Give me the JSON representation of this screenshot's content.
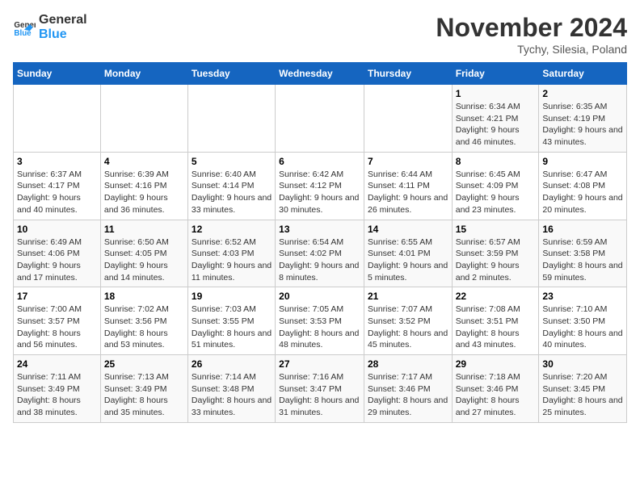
{
  "logo": {
    "general": "General",
    "blue": "Blue"
  },
  "header": {
    "month": "November 2024",
    "location": "Tychy, Silesia, Poland"
  },
  "weekdays": [
    "Sunday",
    "Monday",
    "Tuesday",
    "Wednesday",
    "Thursday",
    "Friday",
    "Saturday"
  ],
  "weeks": [
    [
      {
        "day": "",
        "info": ""
      },
      {
        "day": "",
        "info": ""
      },
      {
        "day": "",
        "info": ""
      },
      {
        "day": "",
        "info": ""
      },
      {
        "day": "",
        "info": ""
      },
      {
        "day": "1",
        "info": "Sunrise: 6:34 AM\nSunset: 4:21 PM\nDaylight: 9 hours and 46 minutes."
      },
      {
        "day": "2",
        "info": "Sunrise: 6:35 AM\nSunset: 4:19 PM\nDaylight: 9 hours and 43 minutes."
      }
    ],
    [
      {
        "day": "3",
        "info": "Sunrise: 6:37 AM\nSunset: 4:17 PM\nDaylight: 9 hours and 40 minutes."
      },
      {
        "day": "4",
        "info": "Sunrise: 6:39 AM\nSunset: 4:16 PM\nDaylight: 9 hours and 36 minutes."
      },
      {
        "day": "5",
        "info": "Sunrise: 6:40 AM\nSunset: 4:14 PM\nDaylight: 9 hours and 33 minutes."
      },
      {
        "day": "6",
        "info": "Sunrise: 6:42 AM\nSunset: 4:12 PM\nDaylight: 9 hours and 30 minutes."
      },
      {
        "day": "7",
        "info": "Sunrise: 6:44 AM\nSunset: 4:11 PM\nDaylight: 9 hours and 26 minutes."
      },
      {
        "day": "8",
        "info": "Sunrise: 6:45 AM\nSunset: 4:09 PM\nDaylight: 9 hours and 23 minutes."
      },
      {
        "day": "9",
        "info": "Sunrise: 6:47 AM\nSunset: 4:08 PM\nDaylight: 9 hours and 20 minutes."
      }
    ],
    [
      {
        "day": "10",
        "info": "Sunrise: 6:49 AM\nSunset: 4:06 PM\nDaylight: 9 hours and 17 minutes."
      },
      {
        "day": "11",
        "info": "Sunrise: 6:50 AM\nSunset: 4:05 PM\nDaylight: 9 hours and 14 minutes."
      },
      {
        "day": "12",
        "info": "Sunrise: 6:52 AM\nSunset: 4:03 PM\nDaylight: 9 hours and 11 minutes."
      },
      {
        "day": "13",
        "info": "Sunrise: 6:54 AM\nSunset: 4:02 PM\nDaylight: 9 hours and 8 minutes."
      },
      {
        "day": "14",
        "info": "Sunrise: 6:55 AM\nSunset: 4:01 PM\nDaylight: 9 hours and 5 minutes."
      },
      {
        "day": "15",
        "info": "Sunrise: 6:57 AM\nSunset: 3:59 PM\nDaylight: 9 hours and 2 minutes."
      },
      {
        "day": "16",
        "info": "Sunrise: 6:59 AM\nSunset: 3:58 PM\nDaylight: 8 hours and 59 minutes."
      }
    ],
    [
      {
        "day": "17",
        "info": "Sunrise: 7:00 AM\nSunset: 3:57 PM\nDaylight: 8 hours and 56 minutes."
      },
      {
        "day": "18",
        "info": "Sunrise: 7:02 AM\nSunset: 3:56 PM\nDaylight: 8 hours and 53 minutes."
      },
      {
        "day": "19",
        "info": "Sunrise: 7:03 AM\nSunset: 3:55 PM\nDaylight: 8 hours and 51 minutes."
      },
      {
        "day": "20",
        "info": "Sunrise: 7:05 AM\nSunset: 3:53 PM\nDaylight: 8 hours and 48 minutes."
      },
      {
        "day": "21",
        "info": "Sunrise: 7:07 AM\nSunset: 3:52 PM\nDaylight: 8 hours and 45 minutes."
      },
      {
        "day": "22",
        "info": "Sunrise: 7:08 AM\nSunset: 3:51 PM\nDaylight: 8 hours and 43 minutes."
      },
      {
        "day": "23",
        "info": "Sunrise: 7:10 AM\nSunset: 3:50 PM\nDaylight: 8 hours and 40 minutes."
      }
    ],
    [
      {
        "day": "24",
        "info": "Sunrise: 7:11 AM\nSunset: 3:49 PM\nDaylight: 8 hours and 38 minutes."
      },
      {
        "day": "25",
        "info": "Sunrise: 7:13 AM\nSunset: 3:49 PM\nDaylight: 8 hours and 35 minutes."
      },
      {
        "day": "26",
        "info": "Sunrise: 7:14 AM\nSunset: 3:48 PM\nDaylight: 8 hours and 33 minutes."
      },
      {
        "day": "27",
        "info": "Sunrise: 7:16 AM\nSunset: 3:47 PM\nDaylight: 8 hours and 31 minutes."
      },
      {
        "day": "28",
        "info": "Sunrise: 7:17 AM\nSunset: 3:46 PM\nDaylight: 8 hours and 29 minutes."
      },
      {
        "day": "29",
        "info": "Sunrise: 7:18 AM\nSunset: 3:46 PM\nDaylight: 8 hours and 27 minutes."
      },
      {
        "day": "30",
        "info": "Sunrise: 7:20 AM\nSunset: 3:45 PM\nDaylight: 8 hours and 25 minutes."
      }
    ]
  ]
}
